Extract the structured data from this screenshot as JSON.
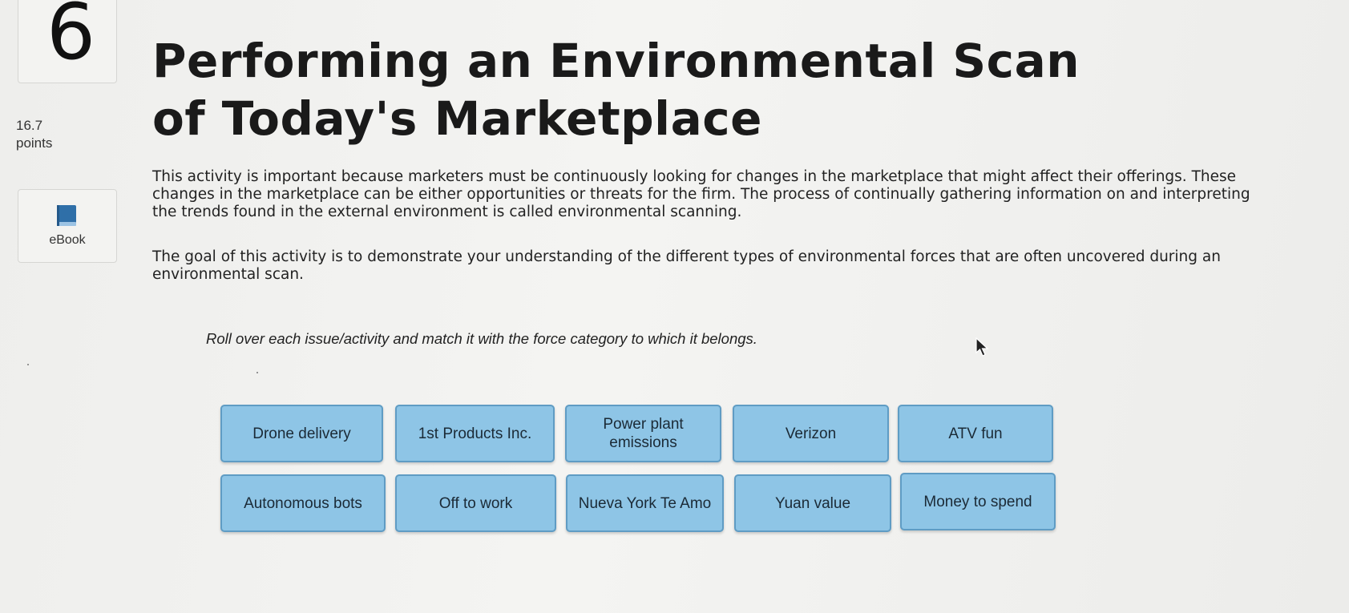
{
  "question": {
    "number": "6",
    "points_value": "16.7",
    "points_label": "points"
  },
  "ebook": {
    "label": "eBook",
    "icon": "book-icon"
  },
  "title": "Performing an Environmental Scan of Today's Marketplace",
  "paragraphs": [
    "This activity is important because marketers must be continuously looking for changes in the marketplace that might affect their offerings. These changes in the marketplace can be either opportunities or threats for the firm. The process of continually gathering information on and interpreting the trends found in the external environment is called environmental scanning.",
    "The goal of this activity is to demonstrate your understanding of the different types of environmental forces that are often uncovered during an environmental scan."
  ],
  "instruction": "Roll over each issue/activity and match it with the force category to which it belongs.",
  "tiles": [
    {
      "label": "Drone delivery"
    },
    {
      "label": "1st Products Inc."
    },
    {
      "label": "Power plant emissions"
    },
    {
      "label": "Verizon"
    },
    {
      "label": "ATV fun"
    },
    {
      "label": "Autonomous bots"
    },
    {
      "label": "Off to work"
    },
    {
      "label": "Nueva York Te Amo"
    },
    {
      "label": "Yuan value"
    },
    {
      "label": "Money to spend"
    }
  ],
  "colors": {
    "tile_fill": "#8ec5e6",
    "tile_border": "#5f9cc4",
    "book_icon": "#2f6fa8"
  }
}
